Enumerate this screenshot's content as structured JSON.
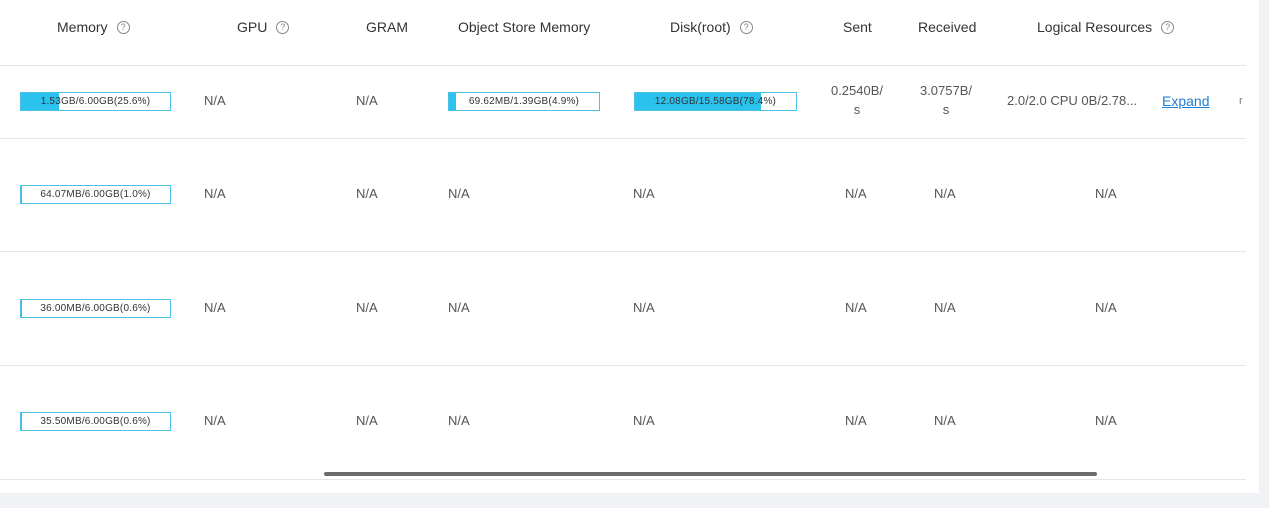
{
  "columns": [
    {
      "label": "Memory",
      "help": true
    },
    {
      "label": "GPU",
      "help": true
    },
    {
      "label": "GRAM",
      "help": false
    },
    {
      "label": "Object Store Memory",
      "help": false
    },
    {
      "label": "Disk(root)",
      "help": true
    },
    {
      "label": "Sent",
      "help": false
    },
    {
      "label": "Received",
      "help": false
    },
    {
      "label": "Logical Resources",
      "help": true
    }
  ],
  "help_icon": "?",
  "rows": [
    {
      "memory": {
        "text": "1.53GB/6.00GB(25.6%)",
        "percent": 25.6
      },
      "gpu": "N/A",
      "gram": "N/A",
      "object_store": {
        "text": "69.62MB/1.39GB(4.9%)",
        "percent": 4.9
      },
      "disk": {
        "text": "12.08GB/15.58GB(78.4%)",
        "percent": 78.4
      },
      "sent": "0.2540B/\ns",
      "received": "3.0757B/\ns",
      "logical": "2.0/2.0 CPU 0B/2.78...",
      "expand": "Expand",
      "overflow_char": "r"
    },
    {
      "memory": {
        "text": "64.07MB/6.00GB(1.0%)",
        "percent": 1.0
      },
      "gpu": "N/A",
      "gram": "N/A",
      "object_store_text": "N/A",
      "disk_text": "N/A",
      "sent": "N/A",
      "received": "N/A",
      "logical": "N/A"
    },
    {
      "memory": {
        "text": "36.00MB/6.00GB(0.6%)",
        "percent": 0.6
      },
      "gpu": "N/A",
      "gram": "N/A",
      "object_store_text": "N/A",
      "disk_text": "N/A",
      "sent": "N/A",
      "received": "N/A",
      "logical": "N/A"
    },
    {
      "memory": {
        "text": "35.50MB/6.00GB(0.6%)",
        "percent": 0.6
      },
      "gpu": "N/A",
      "gram": "N/A",
      "object_store_text": "N/A",
      "disk_text": "N/A",
      "sent": "N/A",
      "received": "N/A",
      "logical": "N/A"
    }
  ],
  "colors": {
    "bar_fill": "#2bc3ee",
    "bar_border": "#4fc1e9",
    "link": "#1e7dd6"
  }
}
